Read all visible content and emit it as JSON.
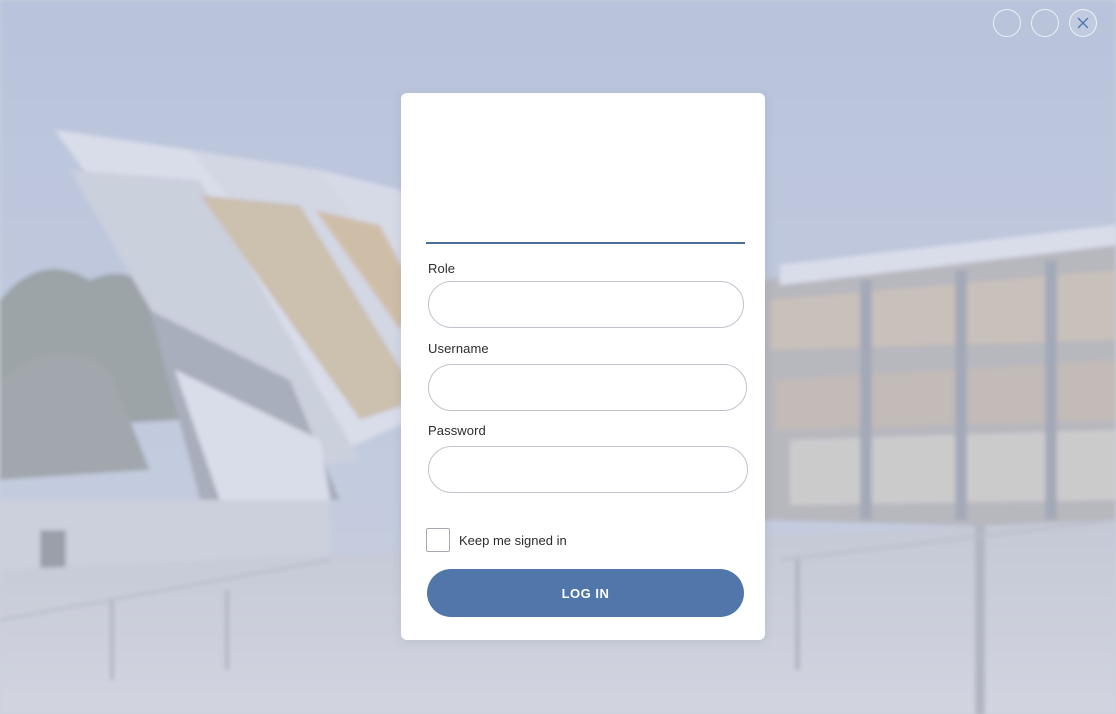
{
  "window_controls": {
    "minimize_icon": "minimize-icon",
    "maximize_icon": "maximize-icon",
    "close_icon": "close-icon"
  },
  "login": {
    "role_label": "Role",
    "role_value": "",
    "username_label": "Username",
    "username_value": "",
    "password_label": "Password",
    "password_value": "",
    "keep_signed_in_label": "Keep me signed in",
    "keep_signed_in_checked": false,
    "submit_label": "LOG IN"
  },
  "colors": {
    "accent": "#5177aa",
    "underline": "#4f6d9c",
    "overlay": "#cdd4e6"
  }
}
